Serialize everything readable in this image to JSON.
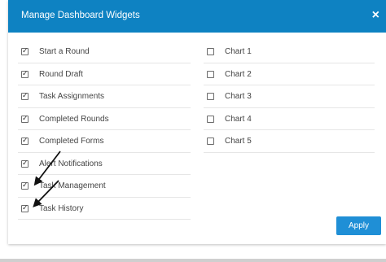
{
  "dialog": {
    "title": "Manage Dashboard Widgets",
    "close_label": "×",
    "apply_label": "Apply"
  },
  "widgets_left": [
    {
      "label": "Start a Round",
      "checked": true
    },
    {
      "label": "Round Draft",
      "checked": true
    },
    {
      "label": "Task Assignments",
      "checked": true
    },
    {
      "label": "Completed Rounds",
      "checked": true
    },
    {
      "label": "Completed Forms",
      "checked": true
    },
    {
      "label": "Alert Notifications",
      "checked": true
    },
    {
      "label": "Task Management",
      "checked": true
    },
    {
      "label": "Task History",
      "checked": true
    }
  ],
  "widgets_right": [
    {
      "label": "Chart 1",
      "checked": false
    },
    {
      "label": "Chart 2",
      "checked": false
    },
    {
      "label": "Chart 3",
      "checked": false
    },
    {
      "label": "Chart 4",
      "checked": false
    },
    {
      "label": "Chart 5",
      "checked": false
    }
  ],
  "colors": {
    "header": "#0e82c2",
    "apply_button": "#1f8fd6"
  }
}
